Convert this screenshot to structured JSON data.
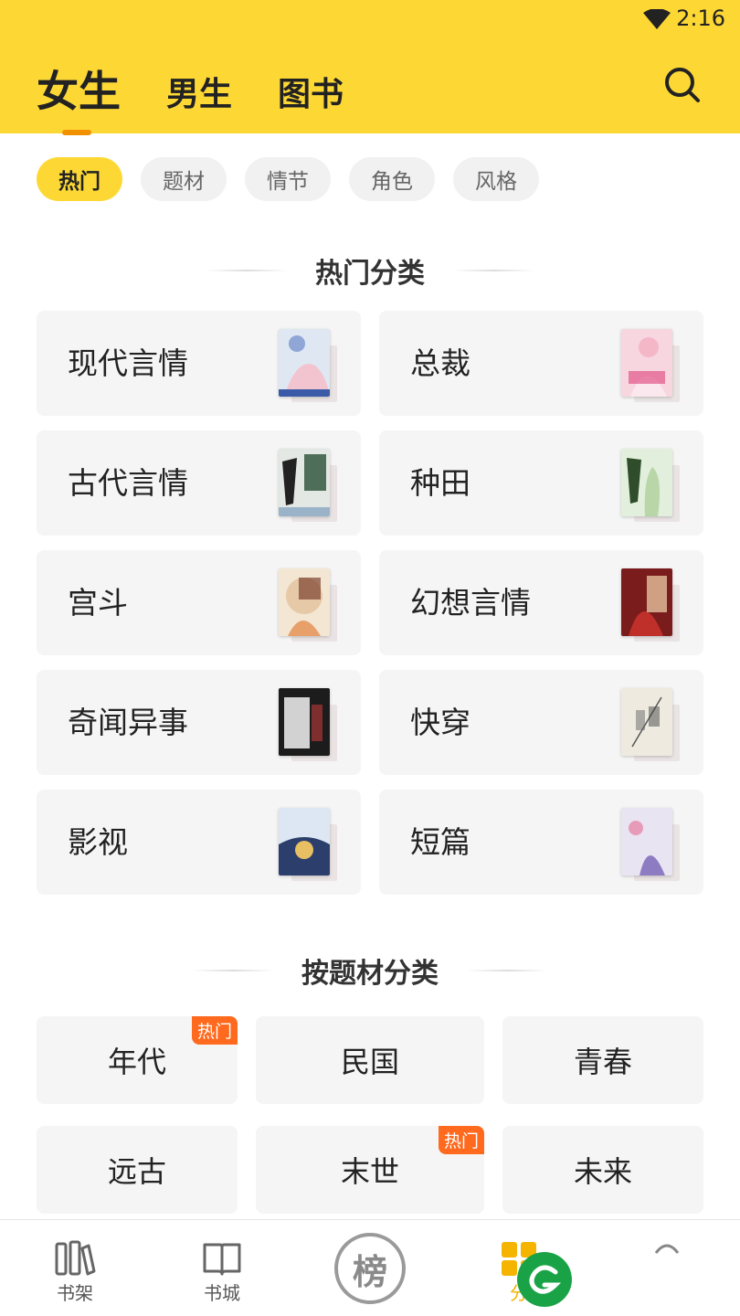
{
  "status": {
    "time": "2:16",
    "wifi_icon": "wifi-icon"
  },
  "header": {
    "tabs": [
      {
        "label": "女生",
        "active": true
      },
      {
        "label": "男生",
        "active": false
      },
      {
        "label": "图书",
        "active": false
      }
    ],
    "search_icon": "search-icon"
  },
  "filters": [
    {
      "label": "热门",
      "active": true
    },
    {
      "label": "题材",
      "active": false
    },
    {
      "label": "情节",
      "active": false
    },
    {
      "label": "角色",
      "active": false
    },
    {
      "label": "风格",
      "active": false
    }
  ],
  "hot_section": {
    "title": "热门分类",
    "categories": [
      {
        "label": "现代言情",
        "cover_color": "#dfe8f2"
      },
      {
        "label": "总裁",
        "cover_color": "#f7d6e0"
      },
      {
        "label": "古代言情",
        "cover_color": "#e3e8e4"
      },
      {
        "label": "种田",
        "cover_color": "#e2efdc"
      },
      {
        "label": "宫斗",
        "cover_color": "#f3e6d3"
      },
      {
        "label": "幻想言情",
        "cover_color": "#7a1c1c"
      },
      {
        "label": "奇闻异事",
        "cover_color": "#1c1c1c"
      },
      {
        "label": "快穿",
        "cover_color": "#eeeae0"
      },
      {
        "label": "影视",
        "cover_color": "#2c3e6b"
      },
      {
        "label": "短篇",
        "cover_color": "#e9e4f2"
      }
    ]
  },
  "theme_section": {
    "title": "按题材分类",
    "items": [
      {
        "label": "年代",
        "badge": "热门"
      },
      {
        "label": "民国",
        "badge": ""
      },
      {
        "label": "青春",
        "badge": ""
      },
      {
        "label": "远古",
        "badge": ""
      },
      {
        "label": "末世",
        "badge": "热门"
      },
      {
        "label": "未来",
        "badge": ""
      }
    ]
  },
  "bottom_nav": {
    "items": [
      {
        "label": "书架",
        "icon": "bookshelf-icon"
      },
      {
        "label": "书城",
        "icon": "book-icon"
      },
      {
        "label": "榜",
        "icon": "ranking-icon"
      },
      {
        "label": "分",
        "icon": "category-icon"
      },
      {
        "label": "",
        "icon": "profile-icon"
      }
    ]
  },
  "colors": {
    "brand_yellow": "#fdd835",
    "accent_orange": "#f29100",
    "badge_orange": "#ff6a1f",
    "fab_green": "#1aa346"
  }
}
